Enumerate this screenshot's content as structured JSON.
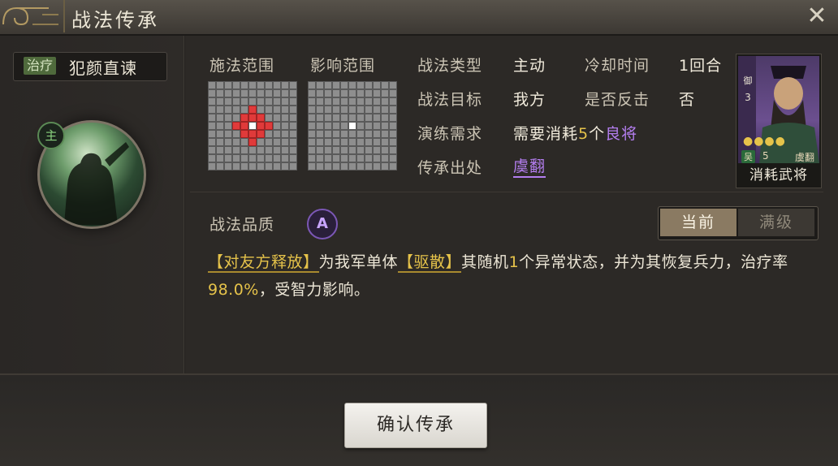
{
  "window": {
    "title": "战法传承"
  },
  "skill": {
    "tag": "治疗",
    "name": "犯颜直谏",
    "badge": "主"
  },
  "range": {
    "cast_label": "施法范围",
    "effect_label": "影响范围",
    "cast_red_cells": [
      [
        3,
        5
      ],
      [
        4,
        4
      ],
      [
        4,
        5
      ],
      [
        4,
        6
      ],
      [
        5,
        3
      ],
      [
        5,
        4
      ],
      [
        5,
        6
      ],
      [
        5,
        7
      ],
      [
        6,
        4
      ],
      [
        6,
        5
      ],
      [
        6,
        6
      ],
      [
        7,
        5
      ]
    ],
    "cast_white_cells": [
      [
        5,
        5
      ]
    ],
    "effect_white_cells": [
      [
        5,
        5
      ]
    ]
  },
  "props": {
    "type_label": "战法类型",
    "type_value": "主动",
    "cooldown_label": "冷却时间",
    "cooldown_value": "1回合",
    "target_label": "战法目标",
    "target_value": "我方",
    "counter_label": "是否反击",
    "counter_value": "否",
    "req_label": "演练需求",
    "req_prefix": "需要消耗",
    "req_count": "5",
    "req_unit": "个",
    "req_quality": "良将",
    "source_label": "传承出处",
    "source_value": "虞翻"
  },
  "general_card": {
    "rank": "御",
    "level": "3",
    "stars": "●●●●",
    "kingdom": "吴",
    "cost": "5",
    "name": "虞翻",
    "label": "消耗武将"
  },
  "quality": {
    "label": "战法品质",
    "grade": "A"
  },
  "toggle": {
    "current": "当前",
    "max": "满级"
  },
  "description": {
    "kw1": "【对友方释放】",
    "t1": "为我军单体",
    "kw2": "【驱散】",
    "t2": "其随机",
    "n1": "1",
    "t3": "个异常状态，并为其恢复兵力，治疗率",
    "n2": "98.0%",
    "t4": "，受智力影响。"
  },
  "footer": {
    "confirm_label": "确认传承"
  },
  "colors": {
    "accent_gold": "#e6c34a",
    "accent_purple": "#b47ef0",
    "heal_tag": "#4f6a3c"
  }
}
